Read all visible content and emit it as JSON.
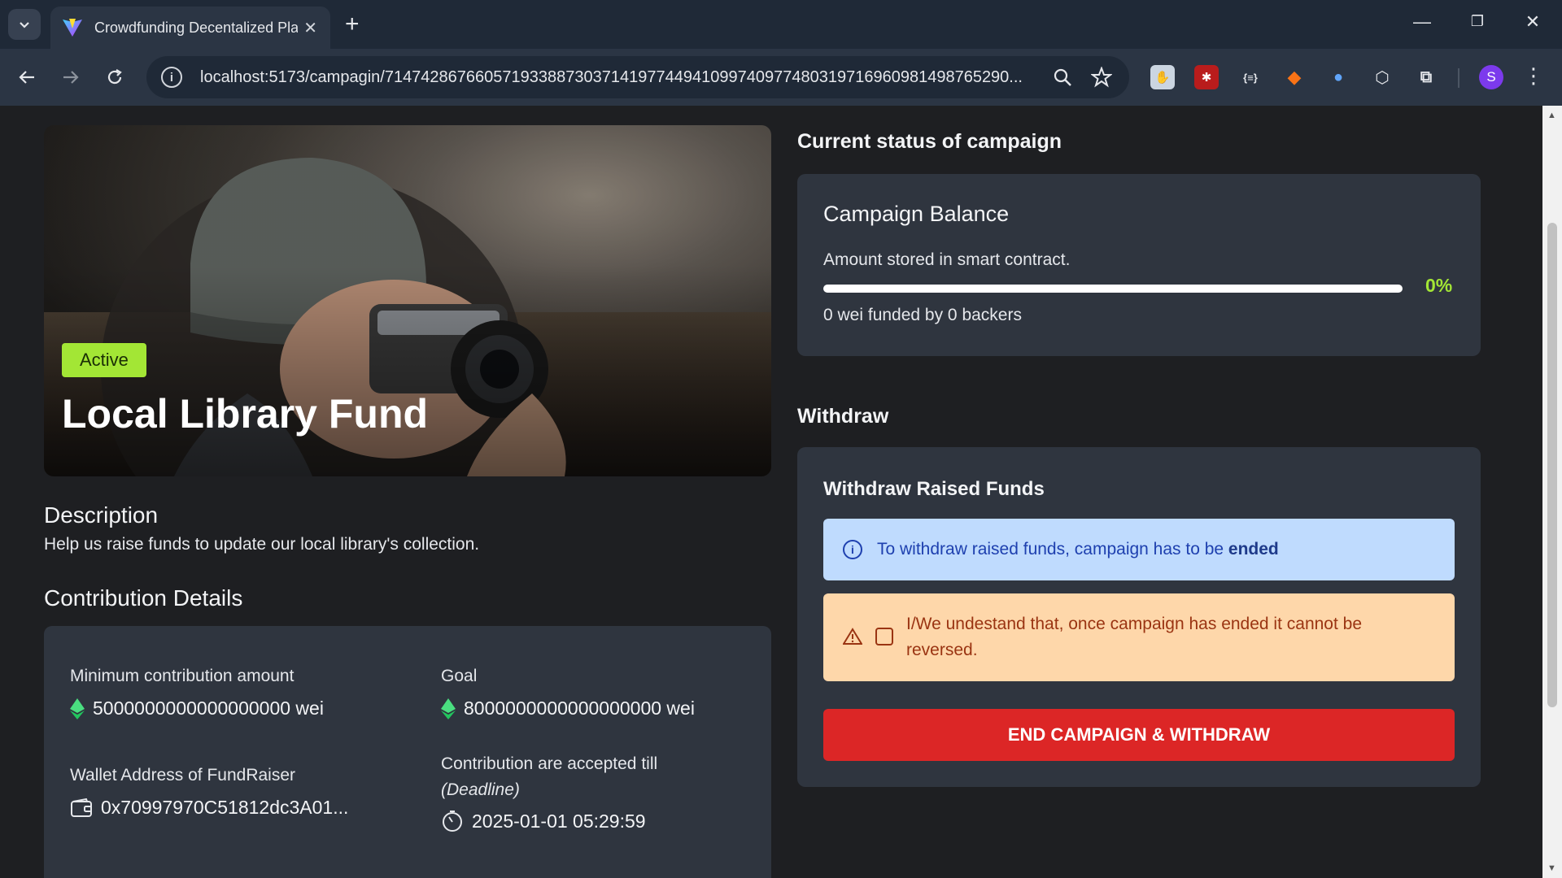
{
  "browser": {
    "tab_title": "Crowdfunding Decentalized Pla",
    "url": "localhost:5173/campagin/714742867660571933887303714197744941099740977480319716960981498765290..."
  },
  "hero": {
    "status_badge": "Active",
    "title": "Local Library Fund"
  },
  "description": {
    "heading": "Description",
    "text": "Help us raise funds to update our local library's collection."
  },
  "contribution": {
    "heading": "Contribution Details",
    "min_label": "Minimum contribution amount",
    "min_value": "5000000000000000000 wei",
    "goal_label": "Goal",
    "goal_value": "8000000000000000000 wei",
    "wallet_label": "Wallet Address of FundRaiser",
    "wallet_value": "0x70997970C51812dc3A01...",
    "deadline_label": "Contribution are accepted till",
    "deadline_sub": "(Deadline)",
    "deadline_value": "2025-01-01 05:29:59"
  },
  "status": {
    "heading": "Current status of campaign",
    "card_title": "Campaign Balance",
    "card_sub": "Amount stored in smart contract.",
    "progress_percent": 0,
    "progress_label": "0%",
    "funded_text": "0 wei funded by 0 backers"
  },
  "withdraw": {
    "heading": "Withdraw",
    "card_title": "Withdraw Raised Funds",
    "info_text_prefix": "To withdraw raised funds, campaign has to be",
    "info_text_bold": "ended",
    "warning_text": "I/We undestand that, once campaign has ended it cannot be reversed.",
    "button_label": "END CAMPAIGN & WITHDRAW"
  },
  "colors": {
    "accent_green": "#a3e635",
    "danger_red": "#dc2626",
    "info_bg": "#bfdbfe",
    "warning_bg": "#fed7aa",
    "card_bg": "#2f353f",
    "page_bg": "#1e1f22"
  },
  "icons": {
    "tab_search": "chevron-down-icon",
    "favicon": "vite-icon",
    "close": "close-icon",
    "back": "arrow-left-icon",
    "forward": "arrow-right-icon",
    "reload": "reload-icon",
    "site_info": "info-icon",
    "zoom": "zoom-icon",
    "bookmark": "star-icon",
    "eth": "ethereum-icon",
    "wallet": "wallet-icon",
    "clock": "timer-icon",
    "warning": "warning-triangle-icon"
  }
}
